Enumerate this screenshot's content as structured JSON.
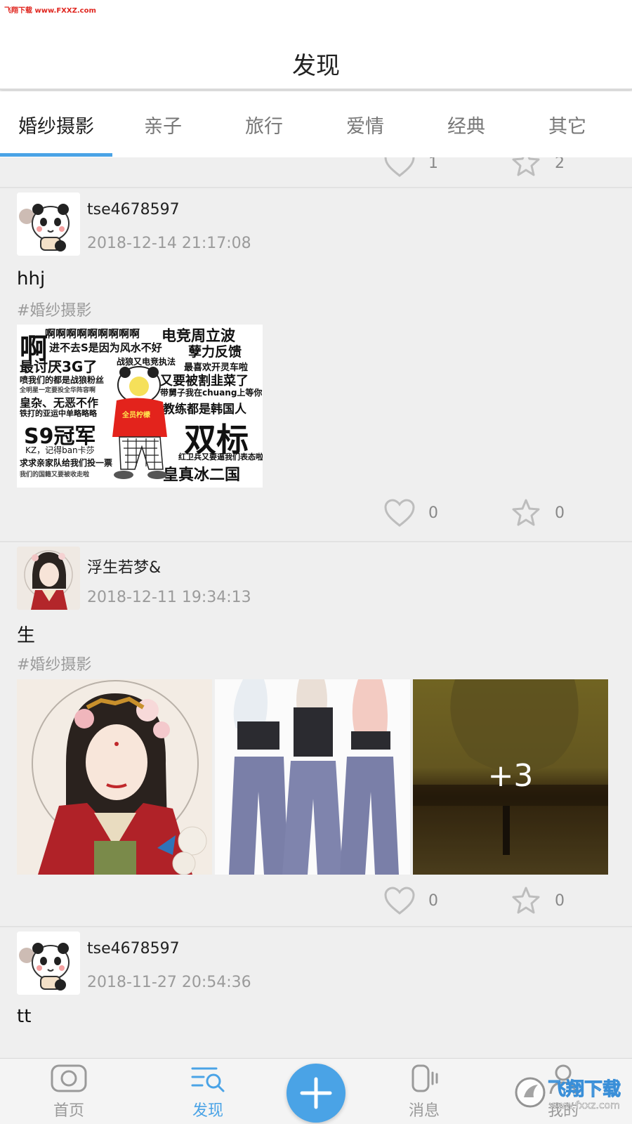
{
  "watermark": "飞翔下载 www.FXXZ.com",
  "header": {
    "title": "发现"
  },
  "tabs": [
    {
      "label": "婚纱摄影",
      "active": true
    },
    {
      "label": "亲子",
      "active": false
    },
    {
      "label": "旅行",
      "active": false
    },
    {
      "label": "爱情",
      "active": false
    },
    {
      "label": "经典",
      "active": false
    },
    {
      "label": "其它",
      "active": false
    }
  ],
  "partial_post": {
    "likes": "1",
    "favorites": "2"
  },
  "posts": [
    {
      "username": "tse4678597",
      "time": "2018-12-14 21:17:08",
      "content": "hhj",
      "tag": "#婚纱摄影",
      "likes": "0",
      "favorites": "0",
      "image_text": {
        "a": "啊",
        "l1": "啊啊啊啊啊啊啊啊啊",
        "l2": "电竞周立波",
        "l3": "进不去S是因为风水不好",
        "l4": "孽力反馈",
        "l5": "最讨厌3G了",
        "l6": "战狼又电竞执法",
        "l7": "最喜欢开灵车啦",
        "l8": "喷我们的都是战狼粉丝",
        "l9": "又要被割韭菜了",
        "l10": "全明星一定要投全华阵容啊",
        "l11": "带舅子我在chuang上等你",
        "l12": "皇杂、无恶不作",
        "l13": "教练都是韩国人",
        "l14": "铁打的亚运中单略略略",
        "l15": "全员柠檬",
        "l16": "S9冠军",
        "l17": "双标",
        "l18": "KZ，记得ban卡莎",
        "l19": "求求亲家队给我们投一票",
        "l20": "红卫兵又要逼我们表态啦",
        "l21": "我们的国籍又要被收走啦",
        "l22": "皇真冰二国"
      }
    },
    {
      "username": "浮生若梦&",
      "time": "2018-12-11 19:34:13",
      "content": "生",
      "tag": "#婚纱摄影",
      "more_images": "+3",
      "likes": "0",
      "favorites": "0"
    },
    {
      "username": "tse4678597",
      "time": "2018-11-27 20:54:36",
      "content": "tt"
    }
  ],
  "bottom_nav": [
    {
      "label": "首页",
      "icon": "camera-icon",
      "active": false
    },
    {
      "label": "发现",
      "icon": "discover-icon",
      "active": true
    },
    {
      "label": "消息",
      "icon": "message-icon",
      "active": false
    },
    {
      "label": "我的",
      "icon": "profile-icon",
      "active": false
    }
  ],
  "brand_logo": {
    "text": "飞翔下载",
    "url_text": "www.fxxz.com"
  },
  "colors": {
    "accent": "#4aa3e6",
    "background": "#efefef",
    "watermark": "#e0261f"
  }
}
